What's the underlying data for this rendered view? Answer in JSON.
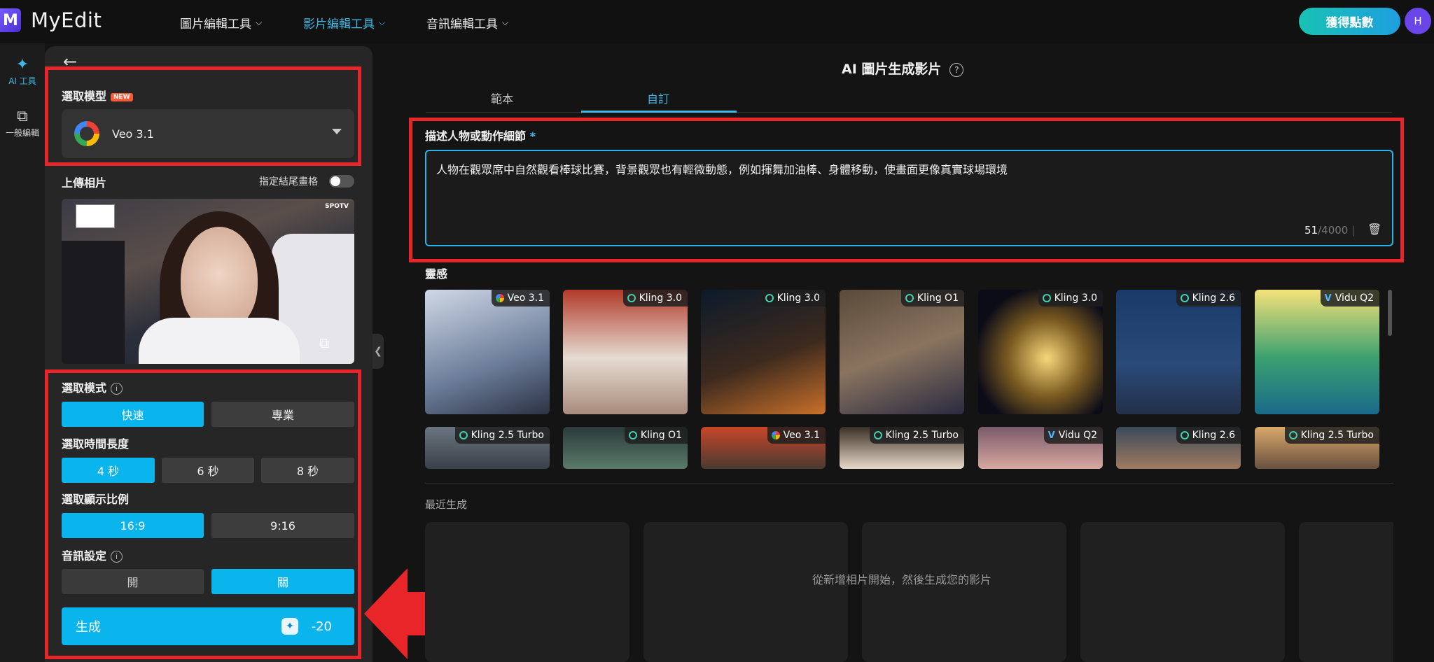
{
  "app": {
    "logo_letter": "M",
    "name": "MyEdit"
  },
  "topnav": [
    {
      "label": "圖片編輯工具",
      "active": false
    },
    {
      "label": "影片編輯工具",
      "active": true
    },
    {
      "label": "音訊編輯工具",
      "active": false
    }
  ],
  "header": {
    "points_button": "獲得點數",
    "avatar_initial": "H"
  },
  "rail": [
    {
      "label": "AI 工具",
      "icon": "magic-wand-icon",
      "active": true
    },
    {
      "label": "一般編輯",
      "icon": "layers-icon",
      "active": false
    }
  ],
  "panel": {
    "model_section_title": "選取模型",
    "new_badge": "NEW",
    "selected_model": "Veo 3.1",
    "upload_title": "上傳相片",
    "end_frame_label": "指定結尾畫格",
    "mode_title": "選取模式",
    "modes": [
      "快速",
      "專業"
    ],
    "selected_mode": "快速",
    "duration_title": "選取時間長度",
    "durations": [
      "4 秒",
      "6 秒",
      "8 秒"
    ],
    "selected_duration": "4 秒",
    "ratio_title": "選取顯示比例",
    "ratios": [
      "16:9",
      "9:16"
    ],
    "selected_ratio": "16:9",
    "audio_title": "音訊設定",
    "audio_options": [
      "開",
      "關"
    ],
    "selected_audio": "關",
    "generate_label": "生成",
    "generate_cost": "-20",
    "photo_overlay_spotv": "SPOTV"
  },
  "main": {
    "title": "AI 圖片生成影片",
    "tabs": [
      "範本",
      "自訂"
    ],
    "active_tab": "自訂",
    "prompt_label": "描述人物或動作細節",
    "required_mark": "*",
    "prompt_text": "人物在觀眾席中自然觀看棒球比賽，背景觀眾也有輕微動態，例如揮舞加油棒、身體移動，使畫面更像真實球場環境",
    "char_count": "51",
    "char_max": "/4000",
    "inspiration_title": "靈感",
    "inspiration_row1": [
      {
        "model": "Veo 3.1",
        "kind": "g"
      },
      {
        "model": "Kling 3.0",
        "kind": "k"
      },
      {
        "model": "Kling 3.0",
        "kind": "k"
      },
      {
        "model": "Kling O1",
        "kind": "k"
      },
      {
        "model": "Kling 3.0",
        "kind": "k"
      },
      {
        "model": "Kling 2.6",
        "kind": "k"
      },
      {
        "model": "Vidu Q2",
        "kind": "v"
      }
    ],
    "inspiration_row2": [
      {
        "model": "Kling 2.5 Turbo",
        "kind": "k"
      },
      {
        "model": "Kling O1",
        "kind": "k"
      },
      {
        "model": "Veo 3.1",
        "kind": "g"
      },
      {
        "model": "Kling 2.5 Turbo",
        "kind": "k"
      },
      {
        "model": "Vidu Q2",
        "kind": "v"
      },
      {
        "model": "Kling 2.6",
        "kind": "k"
      },
      {
        "model": "Kling 2.5 Turbo",
        "kind": "k"
      }
    ],
    "recent_title": "最近生成",
    "recent_empty": "從新增相片開始，然後生成您的影片"
  },
  "colors": {
    "accent": "#0ab4ec",
    "highlight_red": "#e8262a",
    "brand_purple": "#6a46e8"
  }
}
